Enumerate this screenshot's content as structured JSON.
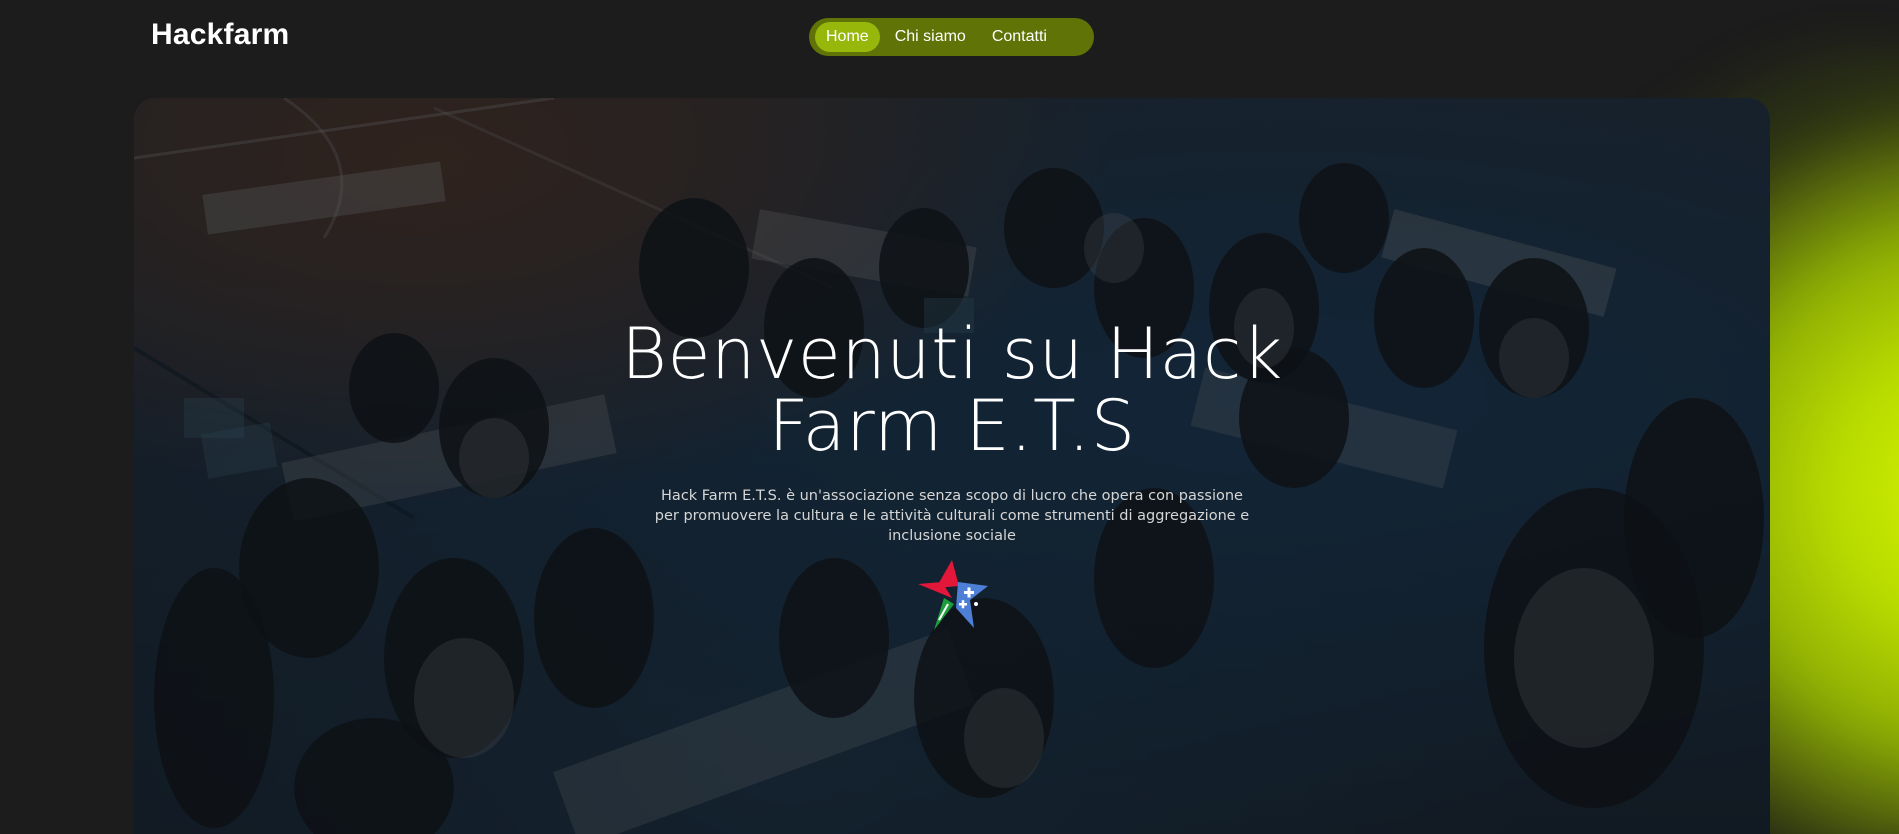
{
  "header": {
    "logo_text": "Hackfarm",
    "nav": [
      {
        "label": "Home",
        "active": true
      },
      {
        "label": "Chi siamo",
        "active": false
      },
      {
        "label": "Contatti",
        "active": false
      }
    ]
  },
  "hero": {
    "title": "Benvenuti su Hack Farm E.T.S",
    "description": "Hack Farm E.T.S. è un'associazione senza scopo di lucro che opera con passione per promuovere la cultura e le attività culturali come strumenti di aggregazione e inclusione sociale",
    "logo_icon": "hackfarm-star-logo-icon",
    "background_image": "hackathon-participants-photo"
  },
  "colors": {
    "page_background": "#1c1c1c",
    "accent_lime": "#c6e800",
    "nav_pill": "#5f7306",
    "nav_active": "#97b70b",
    "star_red": "#e3173a",
    "star_green": "#1e9e3a",
    "star_blue": "#4d7fd6"
  }
}
